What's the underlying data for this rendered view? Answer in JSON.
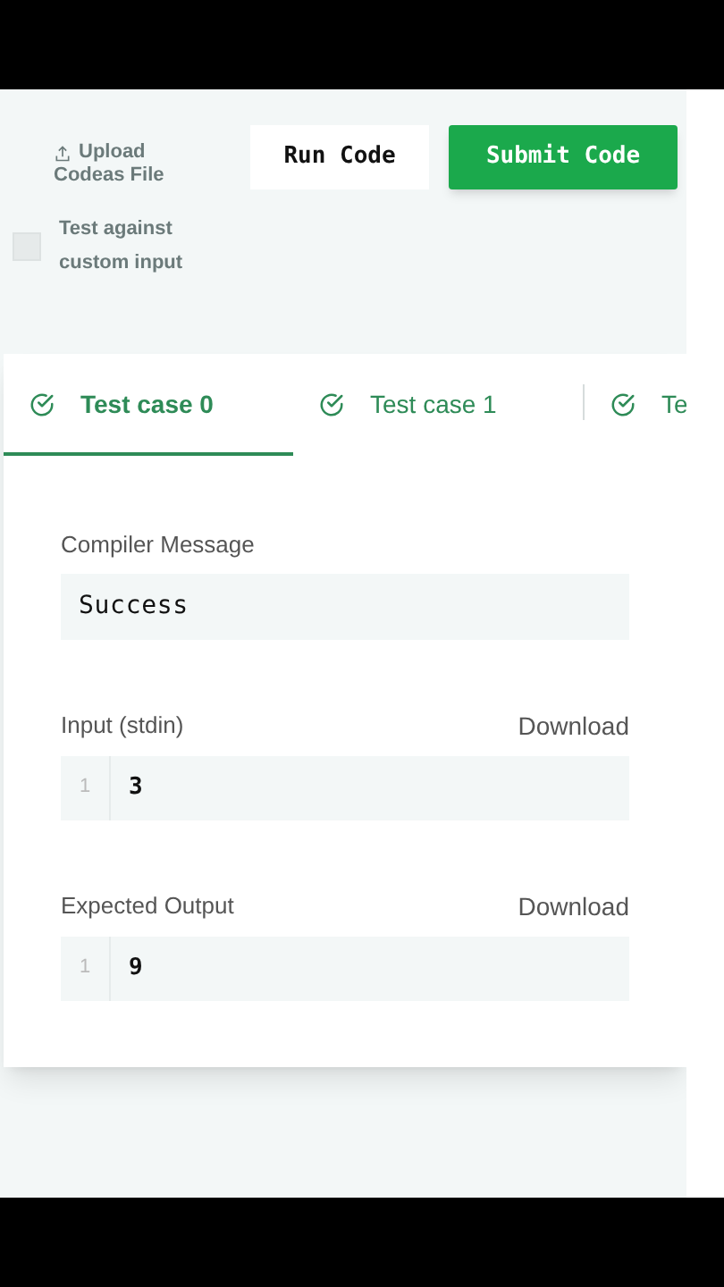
{
  "toolbar": {
    "upload": {
      "line_1": "Upload",
      "line_2": "Codeas File"
    },
    "run_button": "Run Code",
    "submit_button": "Submit Code",
    "custom_input": {
      "label_line_1": "Test against",
      "label_line_2": "custom input",
      "checked": false
    }
  },
  "tabs": [
    {
      "label": "Test case 0",
      "selected": true
    },
    {
      "label": "Test case 1",
      "selected": false
    },
    {
      "label": "Te",
      "selected": false
    }
  ],
  "compiler_message": {
    "label": "Compiler Message",
    "value": "Success"
  },
  "sections": [
    {
      "label": "Input (stdin)",
      "action": "Download",
      "line_number": "1",
      "value": "3"
    },
    {
      "label": "Expected Output",
      "action": "Download",
      "line_number": "1",
      "value": "9"
    }
  ]
}
